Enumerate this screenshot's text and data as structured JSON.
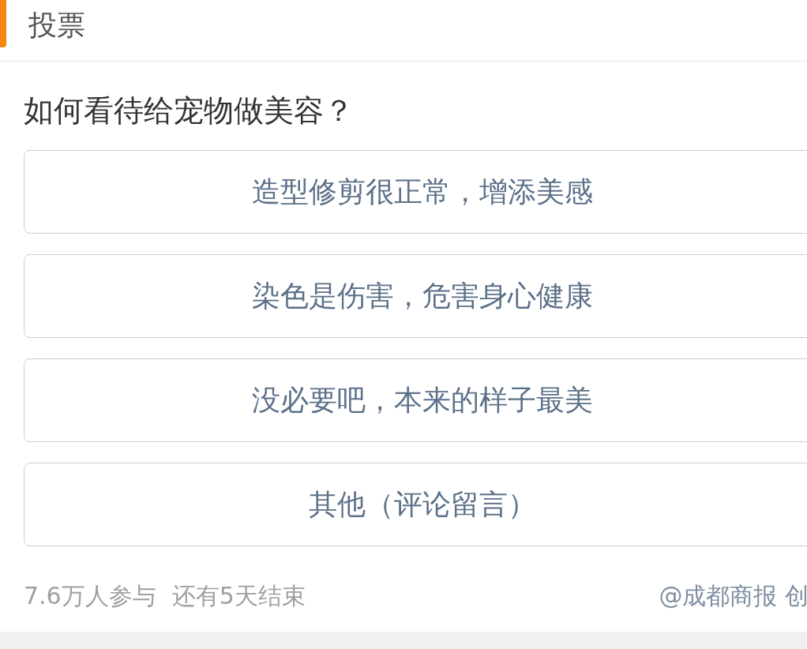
{
  "header": {
    "title": "投票"
  },
  "question": "如何看待给宠物做美容？",
  "options": [
    {
      "label": "造型修剪很正常，增添美感"
    },
    {
      "label": "染色是伤害，危害身心健康"
    },
    {
      "label": "没必要吧，本来的样子最美"
    },
    {
      "label": "其他（评论留言）"
    }
  ],
  "footer": {
    "participants": "7.6万人参与",
    "remaining": "还有5天结束",
    "source": "@成都商报 创"
  }
}
